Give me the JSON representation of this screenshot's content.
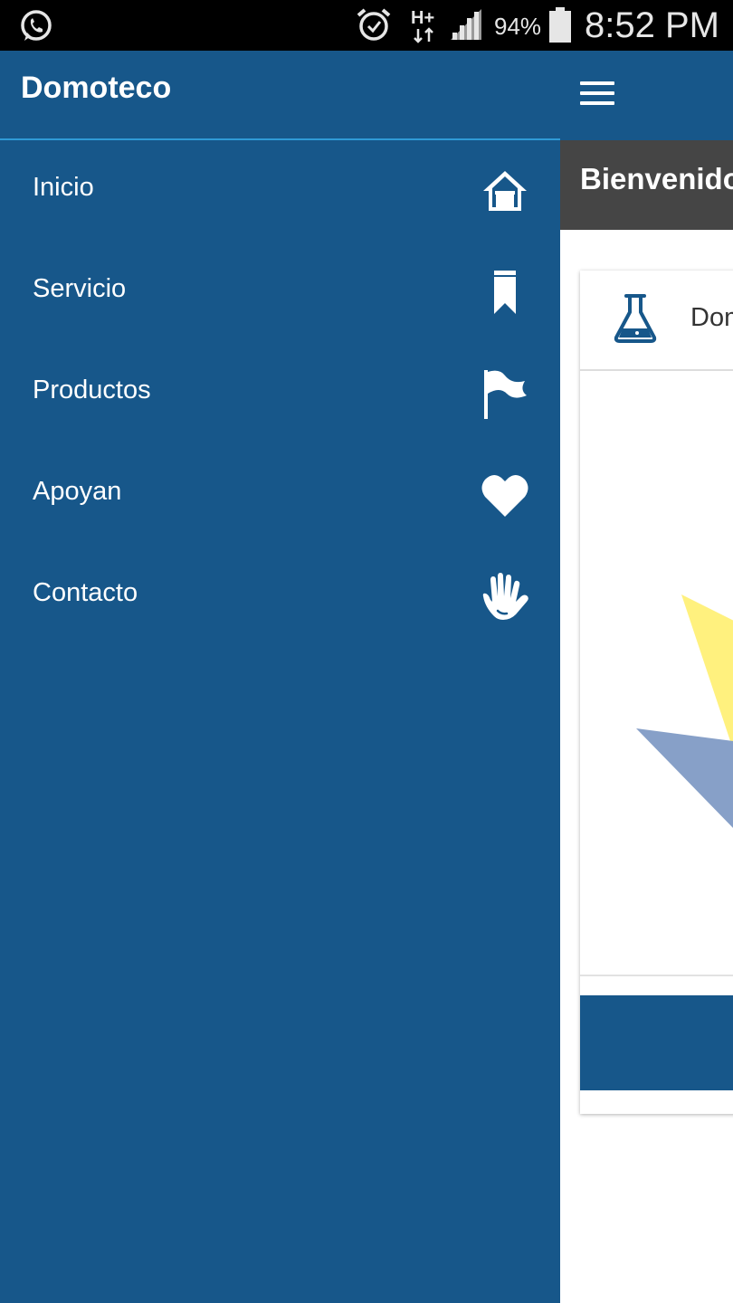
{
  "status_bar": {
    "battery_percent": "94%",
    "time": "8:52 PM",
    "icons": [
      "whatsapp-icon",
      "alarm-icon",
      "network-hplus-icon",
      "signal-icon",
      "battery-icon"
    ]
  },
  "drawer": {
    "title": "Domoteco",
    "items": [
      {
        "label": "Inicio",
        "icon": "home-icon"
      },
      {
        "label": "Servicio",
        "icon": "bookmark-icon"
      },
      {
        "label": "Productos",
        "icon": "flag-icon"
      },
      {
        "label": "Apoyan",
        "icon": "heart-icon"
      },
      {
        "label": "Contacto",
        "icon": "hand-icon"
      }
    ]
  },
  "app": {
    "welcome_title": "Bienvenido",
    "card": {
      "header_text": "Domoteco",
      "header_icon": "flask-icon"
    }
  },
  "colors": {
    "primary": "#17578a",
    "drawer_divider": "#2f9ad6",
    "welcome_bar": "#454545",
    "status_bar": "#000000",
    "flask_icon": "#17578a"
  }
}
